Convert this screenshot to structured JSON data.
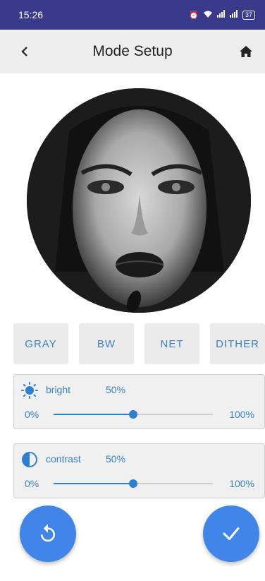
{
  "status_bar": {
    "time": "15:26",
    "battery": "37"
  },
  "app_bar": {
    "title": "Mode Setup"
  },
  "modes": [
    {
      "label": "GRAY"
    },
    {
      "label": "BW"
    },
    {
      "label": "NET"
    },
    {
      "label": "DITHER"
    }
  ],
  "bright": {
    "label": "bright",
    "value": "50%",
    "min": "0%",
    "max": "100%",
    "level": 0.5
  },
  "contrast": {
    "label": "contrast",
    "value": "50%",
    "min": "0%",
    "max": "100%",
    "level": 0.5
  },
  "icons": {
    "back": "chevron-left-icon",
    "home": "home-icon",
    "bright": "sun-icon",
    "contrast": "contrast-icon",
    "reset": "reset-icon",
    "apply": "check-icon"
  },
  "colors": {
    "accent": "#3b82c4",
    "fab": "#4285e8",
    "status_bar": "#3a3a8c"
  }
}
